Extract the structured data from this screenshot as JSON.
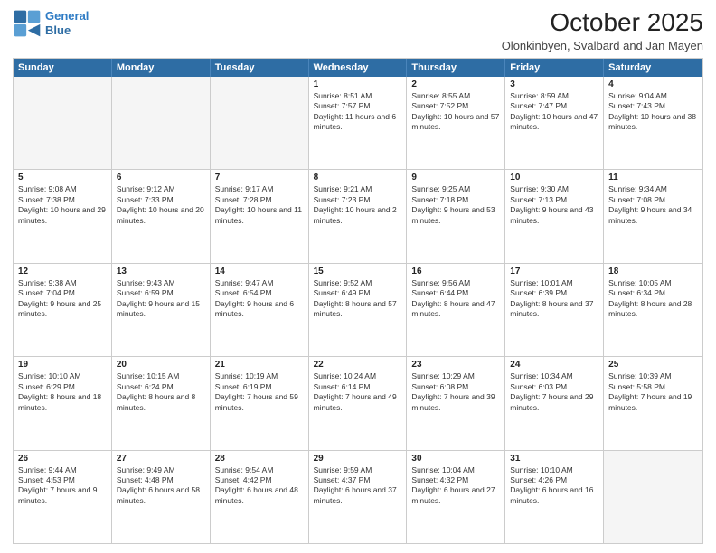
{
  "logo": {
    "line1": "General",
    "line2": "Blue"
  },
  "title": "October 2025",
  "location": "Olonkinbyen, Svalbard and Jan Mayen",
  "days_of_week": [
    "Sunday",
    "Monday",
    "Tuesday",
    "Wednesday",
    "Thursday",
    "Friday",
    "Saturday"
  ],
  "weeks": [
    [
      {
        "day": "",
        "sunrise": "",
        "sunset": "",
        "daylight": "",
        "empty": true
      },
      {
        "day": "",
        "sunrise": "",
        "sunset": "",
        "daylight": "",
        "empty": true
      },
      {
        "day": "",
        "sunrise": "",
        "sunset": "",
        "daylight": "",
        "empty": true
      },
      {
        "day": "1",
        "sunrise": "Sunrise: 8:51 AM",
        "sunset": "Sunset: 7:57 PM",
        "daylight": "Daylight: 11 hours and 6 minutes.",
        "empty": false
      },
      {
        "day": "2",
        "sunrise": "Sunrise: 8:55 AM",
        "sunset": "Sunset: 7:52 PM",
        "daylight": "Daylight: 10 hours and 57 minutes.",
        "empty": false
      },
      {
        "day": "3",
        "sunrise": "Sunrise: 8:59 AM",
        "sunset": "Sunset: 7:47 PM",
        "daylight": "Daylight: 10 hours and 47 minutes.",
        "empty": false
      },
      {
        "day": "4",
        "sunrise": "Sunrise: 9:04 AM",
        "sunset": "Sunset: 7:43 PM",
        "daylight": "Daylight: 10 hours and 38 minutes.",
        "empty": false
      }
    ],
    [
      {
        "day": "5",
        "sunrise": "Sunrise: 9:08 AM",
        "sunset": "Sunset: 7:38 PM",
        "daylight": "Daylight: 10 hours and 29 minutes.",
        "empty": false
      },
      {
        "day": "6",
        "sunrise": "Sunrise: 9:12 AM",
        "sunset": "Sunset: 7:33 PM",
        "daylight": "Daylight: 10 hours and 20 minutes.",
        "empty": false
      },
      {
        "day": "7",
        "sunrise": "Sunrise: 9:17 AM",
        "sunset": "Sunset: 7:28 PM",
        "daylight": "Daylight: 10 hours and 11 minutes.",
        "empty": false
      },
      {
        "day": "8",
        "sunrise": "Sunrise: 9:21 AM",
        "sunset": "Sunset: 7:23 PM",
        "daylight": "Daylight: 10 hours and 2 minutes.",
        "empty": false
      },
      {
        "day": "9",
        "sunrise": "Sunrise: 9:25 AM",
        "sunset": "Sunset: 7:18 PM",
        "daylight": "Daylight: 9 hours and 53 minutes.",
        "empty": false
      },
      {
        "day": "10",
        "sunrise": "Sunrise: 9:30 AM",
        "sunset": "Sunset: 7:13 PM",
        "daylight": "Daylight: 9 hours and 43 minutes.",
        "empty": false
      },
      {
        "day": "11",
        "sunrise": "Sunrise: 9:34 AM",
        "sunset": "Sunset: 7:08 PM",
        "daylight": "Daylight: 9 hours and 34 minutes.",
        "empty": false
      }
    ],
    [
      {
        "day": "12",
        "sunrise": "Sunrise: 9:38 AM",
        "sunset": "Sunset: 7:04 PM",
        "daylight": "Daylight: 9 hours and 25 minutes.",
        "empty": false
      },
      {
        "day": "13",
        "sunrise": "Sunrise: 9:43 AM",
        "sunset": "Sunset: 6:59 PM",
        "daylight": "Daylight: 9 hours and 15 minutes.",
        "empty": false
      },
      {
        "day": "14",
        "sunrise": "Sunrise: 9:47 AM",
        "sunset": "Sunset: 6:54 PM",
        "daylight": "Daylight: 9 hours and 6 minutes.",
        "empty": false
      },
      {
        "day": "15",
        "sunrise": "Sunrise: 9:52 AM",
        "sunset": "Sunset: 6:49 PM",
        "daylight": "Daylight: 8 hours and 57 minutes.",
        "empty": false
      },
      {
        "day": "16",
        "sunrise": "Sunrise: 9:56 AM",
        "sunset": "Sunset: 6:44 PM",
        "daylight": "Daylight: 8 hours and 47 minutes.",
        "empty": false
      },
      {
        "day": "17",
        "sunrise": "Sunrise: 10:01 AM",
        "sunset": "Sunset: 6:39 PM",
        "daylight": "Daylight: 8 hours and 37 minutes.",
        "empty": false
      },
      {
        "day": "18",
        "sunrise": "Sunrise: 10:05 AM",
        "sunset": "Sunset: 6:34 PM",
        "daylight": "Daylight: 8 hours and 28 minutes.",
        "empty": false
      }
    ],
    [
      {
        "day": "19",
        "sunrise": "Sunrise: 10:10 AM",
        "sunset": "Sunset: 6:29 PM",
        "daylight": "Daylight: 8 hours and 18 minutes.",
        "empty": false
      },
      {
        "day": "20",
        "sunrise": "Sunrise: 10:15 AM",
        "sunset": "Sunset: 6:24 PM",
        "daylight": "Daylight: 8 hours and 8 minutes.",
        "empty": false
      },
      {
        "day": "21",
        "sunrise": "Sunrise: 10:19 AM",
        "sunset": "Sunset: 6:19 PM",
        "daylight": "Daylight: 7 hours and 59 minutes.",
        "empty": false
      },
      {
        "day": "22",
        "sunrise": "Sunrise: 10:24 AM",
        "sunset": "Sunset: 6:14 PM",
        "daylight": "Daylight: 7 hours and 49 minutes.",
        "empty": false
      },
      {
        "day": "23",
        "sunrise": "Sunrise: 10:29 AM",
        "sunset": "Sunset: 6:08 PM",
        "daylight": "Daylight: 7 hours and 39 minutes.",
        "empty": false
      },
      {
        "day": "24",
        "sunrise": "Sunrise: 10:34 AM",
        "sunset": "Sunset: 6:03 PM",
        "daylight": "Daylight: 7 hours and 29 minutes.",
        "empty": false
      },
      {
        "day": "25",
        "sunrise": "Sunrise: 10:39 AM",
        "sunset": "Sunset: 5:58 PM",
        "daylight": "Daylight: 7 hours and 19 minutes.",
        "empty": false
      }
    ],
    [
      {
        "day": "26",
        "sunrise": "Sunrise: 9:44 AM",
        "sunset": "Sunset: 4:53 PM",
        "daylight": "Daylight: 7 hours and 9 minutes.",
        "empty": false
      },
      {
        "day": "27",
        "sunrise": "Sunrise: 9:49 AM",
        "sunset": "Sunset: 4:48 PM",
        "daylight": "Daylight: 6 hours and 58 minutes.",
        "empty": false
      },
      {
        "day": "28",
        "sunrise": "Sunrise: 9:54 AM",
        "sunset": "Sunset: 4:42 PM",
        "daylight": "Daylight: 6 hours and 48 minutes.",
        "empty": false
      },
      {
        "day": "29",
        "sunrise": "Sunrise: 9:59 AM",
        "sunset": "Sunset: 4:37 PM",
        "daylight": "Daylight: 6 hours and 37 minutes.",
        "empty": false
      },
      {
        "day": "30",
        "sunrise": "Sunrise: 10:04 AM",
        "sunset": "Sunset: 4:32 PM",
        "daylight": "Daylight: 6 hours and 27 minutes.",
        "empty": false
      },
      {
        "day": "31",
        "sunrise": "Sunrise: 10:10 AM",
        "sunset": "Sunset: 4:26 PM",
        "daylight": "Daylight: 6 hours and 16 minutes.",
        "empty": false
      },
      {
        "day": "",
        "sunrise": "",
        "sunset": "",
        "daylight": "",
        "empty": true
      }
    ]
  ]
}
